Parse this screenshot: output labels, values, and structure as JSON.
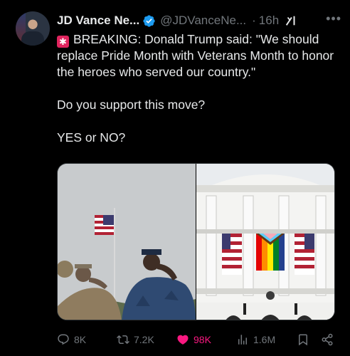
{
  "author": {
    "name": "JD Vance Ne...",
    "handle": "@JDVanceNe...",
    "separator": "·",
    "time": "16h",
    "more_icon": "more-horizontal-icon",
    "verified_color": "#1d9bf0"
  },
  "post": {
    "siren_icon": "🚨",
    "line1": "BREAKING: Donald Trump said: \"We should replace Pride Month with Veterans Month to honor the heroes who served our country.\"",
    "line2": "Do you support this move?",
    "line3": "YES or NO?"
  },
  "media": {
    "left_image": "soldiers-saluting-flag-photo",
    "right_image": "white-house-pride-flag-photo"
  },
  "actions": {
    "replies": "8K",
    "reposts": "7.2K",
    "likes": "98K",
    "views": "1.6M",
    "like_color": "#f91880"
  }
}
